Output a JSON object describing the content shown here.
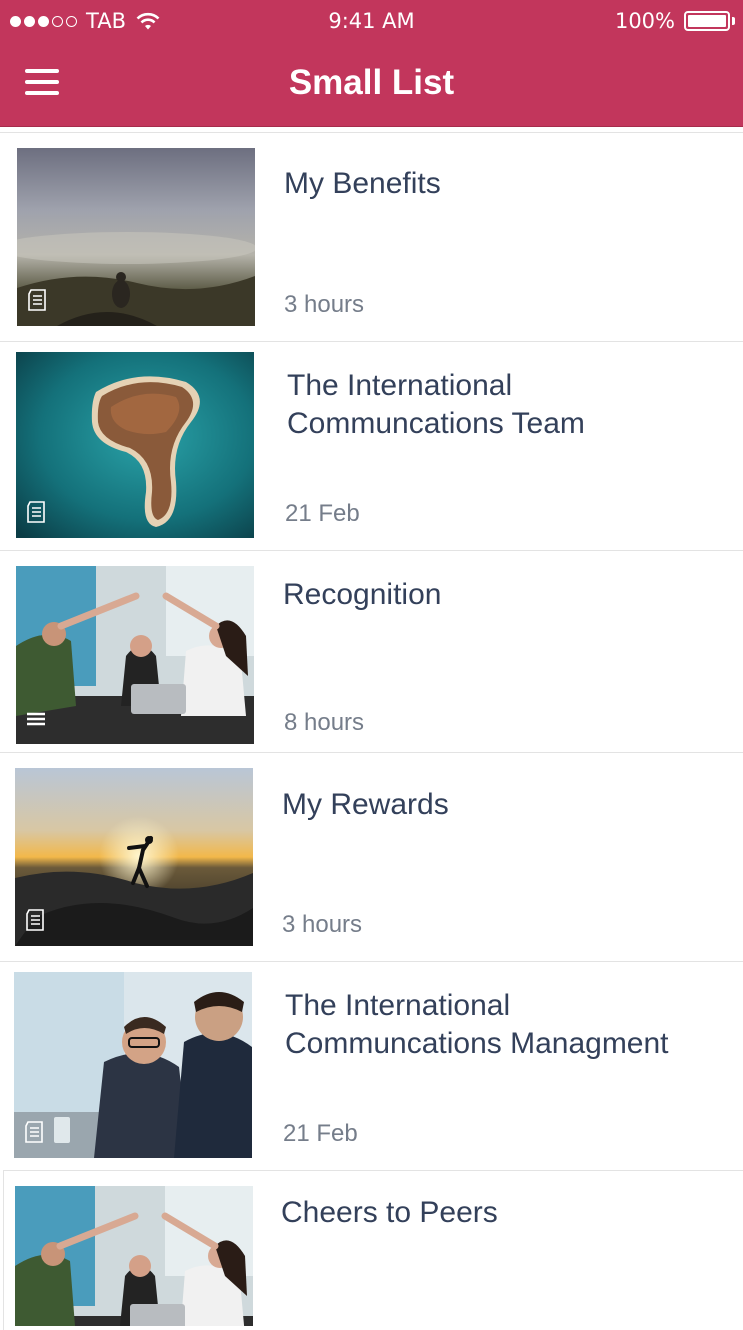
{
  "status_bar": {
    "carrier": "TAB",
    "time": "9:41 AM",
    "battery": "100%",
    "signal_bars": 3
  },
  "header": {
    "title": "Small List",
    "menu_icon": "hamburger-menu-icon",
    "background": "#c2365c"
  },
  "items": [
    {
      "title": "My Benefits",
      "time": "3 hours",
      "type_icon": "article-icon",
      "image": "foggy-mountain-photo"
    },
    {
      "title": "The International\nCommuncations Team",
      "time": "21 Feb",
      "type_icon": "article-icon",
      "image": "island-aerial-photo"
    },
    {
      "title": "Recognition",
      "time": "8 hours",
      "type_icon": "list-icon",
      "image": "team-high-five-photo"
    },
    {
      "title": "My Rewards",
      "time": "3 hours",
      "type_icon": "article-icon",
      "image": "skatepark-sunset-photo"
    },
    {
      "title": "The International\nCommuncations Managment",
      "time": "21 Feb",
      "type_icon": "article-icon",
      "image": "business-meeting-photo"
    },
    {
      "title": "Cheers to Peers",
      "time": "",
      "type_icon": "article-icon",
      "image": "team-high-five-photo"
    }
  ]
}
